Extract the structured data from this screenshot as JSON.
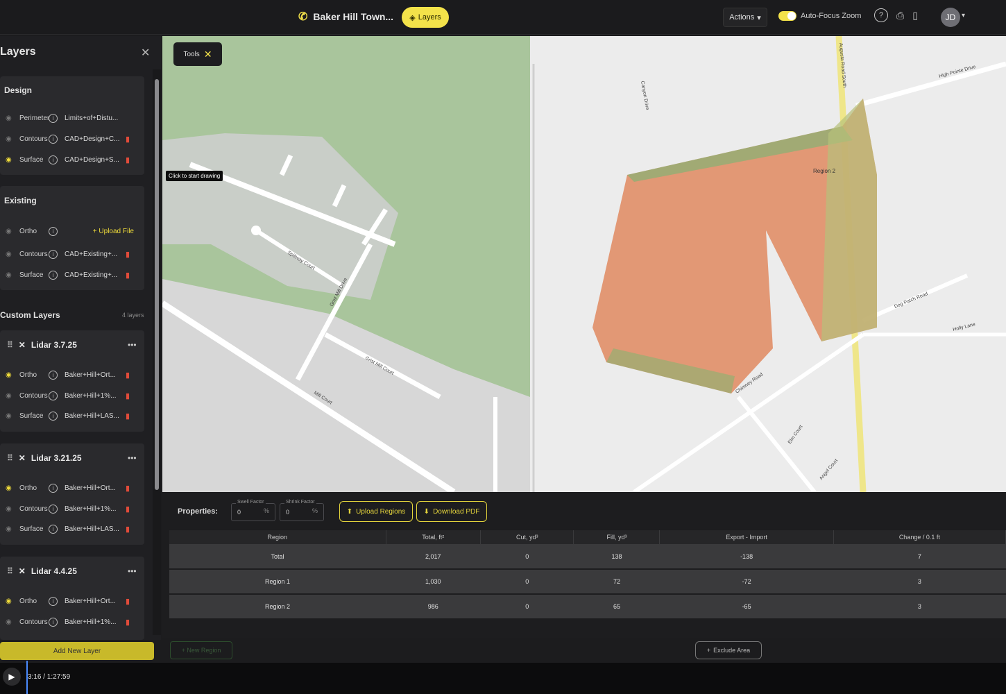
{
  "header": {
    "project_name": "Baker Hill Town...",
    "layers_pill_label": "Layers",
    "actions_label": "Actions",
    "autofocus_label": "Auto-Focus Zoom",
    "avatar_initials": "JD"
  },
  "sidebar": {
    "title": "Layers",
    "design": {
      "heading": "Design",
      "rows": [
        {
          "name": "Perimeter",
          "value": "Limits+of+Distu...",
          "visible": false
        },
        {
          "name": "Contours",
          "value": "CAD+Design+C...",
          "visible": false
        },
        {
          "name": "Surface",
          "value": "CAD+Design+S...",
          "visible": true
        }
      ]
    },
    "existing": {
      "heading": "Existing",
      "ortho_name": "Ortho",
      "upload_label": "+ Upload File",
      "rows": [
        {
          "name": "Contours",
          "value": "CAD+Existing+..."
        },
        {
          "name": "Surface",
          "value": "CAD+Existing+..."
        }
      ]
    },
    "custom_heading": "Custom Layers",
    "custom_count": "4 layers",
    "lidars": [
      {
        "title": "Lidar 3.7.25",
        "rows": [
          {
            "name": "Ortho",
            "value": "Baker+Hill+Ort...",
            "visible": true
          },
          {
            "name": "Contours",
            "value": "Baker+Hill+1%...",
            "visible": false
          },
          {
            "name": "Surface",
            "value": "Baker+Hill+LAS...",
            "visible": false
          }
        ]
      },
      {
        "title": "Lidar 3.21.25",
        "rows": [
          {
            "name": "Ortho",
            "value": "Baker+Hill+Ort...",
            "visible": true
          },
          {
            "name": "Contours",
            "value": "Baker+Hill+1%...",
            "visible": false
          },
          {
            "name": "Surface",
            "value": "Baker+Hill+LAS...",
            "visible": false
          }
        ]
      },
      {
        "title": "Lidar 4.4.25",
        "rows": [
          {
            "name": "Ortho",
            "value": "Baker+Hill+Ort...",
            "visible": true
          },
          {
            "name": "Contours",
            "value": "Baker+Hill+1%...",
            "visible": false
          }
        ]
      }
    ],
    "add_layer_label": "Add New Layer"
  },
  "map": {
    "tools_label": "Tools",
    "tooltip": "Click to start drawing",
    "streets": [
      "Spillway Court",
      "Grist Mill Drive",
      "Grist Mill Court",
      "Mill Court",
      "Chimney Road",
      "Dog Patch Road",
      "Holly Lane",
      "High Pointe Drive",
      "Canyon Drive",
      "Elm Court",
      "Angel Court",
      "Augusta Road South"
    ],
    "region_label": "Region 2"
  },
  "properties": {
    "label": "Properties:",
    "swell_label": "Swell Factor",
    "swell_value": "0",
    "shrink_label": "Shrink Factor",
    "shrink_value": "0",
    "percent": "%",
    "upload_regions": "Upload Regions",
    "download_pdf": "Download PDF",
    "exclude_area": "Exclude Area",
    "new_region": "+ New Region"
  },
  "table": {
    "headers": [
      "Region",
      "Total, ft²",
      "Cut, yd³",
      "Fill, yd³",
      "Export - Import",
      "Change / 0.1 ft"
    ],
    "rows": [
      [
        "Total",
        "2,017",
        "0",
        "138",
        "-138",
        "7"
      ],
      [
        "Region 1",
        "1,030",
        "0",
        "72",
        "-72",
        "3"
      ],
      [
        "Region 2",
        "986",
        "0",
        "65",
        "-65",
        "3"
      ]
    ]
  },
  "video": {
    "timecode": "3:16 / 1:27:59"
  }
}
